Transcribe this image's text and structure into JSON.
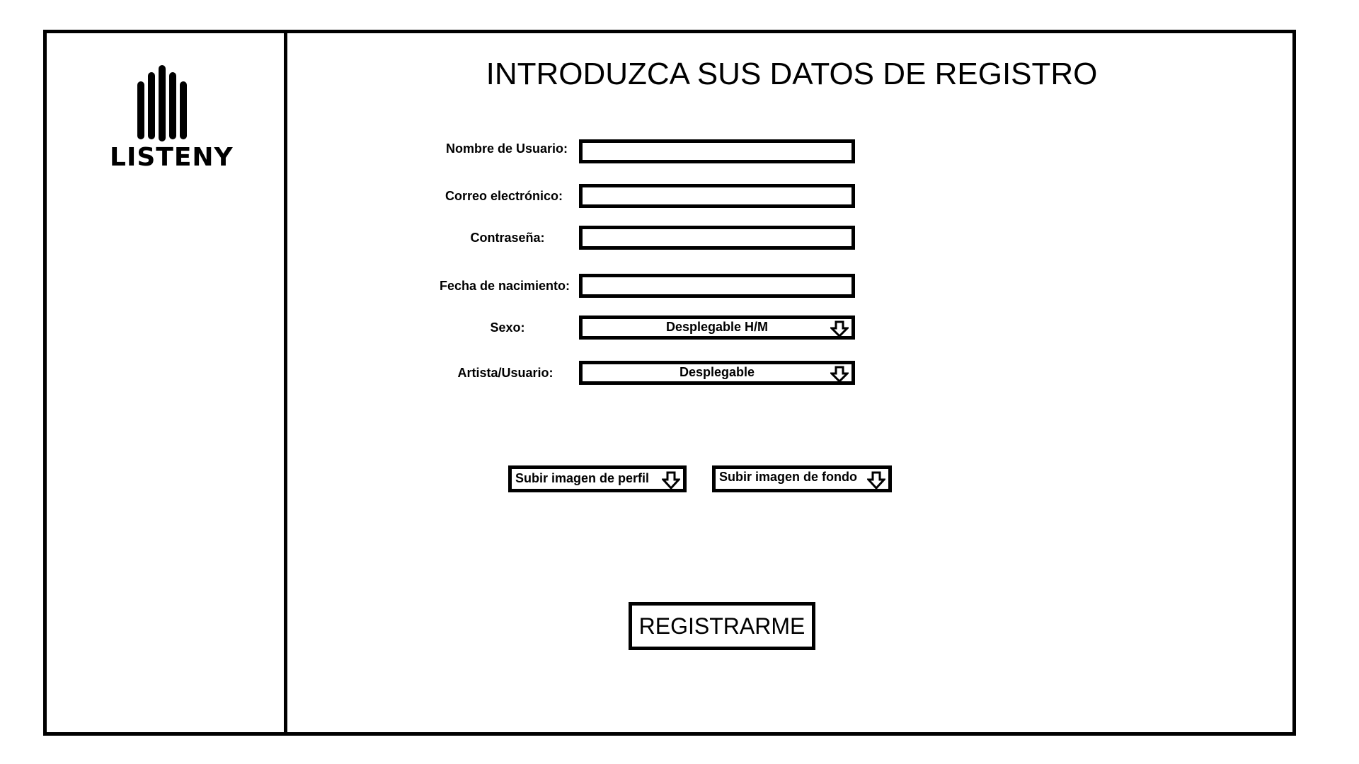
{
  "logo": {
    "text": "LISTENY",
    "icon": "sound-bars-icon"
  },
  "title": "INTRODUZCA SUS DATOS DE REGISTRO",
  "form": {
    "username_label": "Nombre de Usuario:",
    "username_value": "",
    "email_label": "Correo electrónico:",
    "email_value": "",
    "password_label": "Contraseña:",
    "password_value": "",
    "birthdate_label": "Fecha de nacimiento:",
    "birthdate_value": "",
    "sex_label": "Sexo:",
    "sex_value": "Desplegable H/M",
    "role_label": "Artista/Usuario:",
    "role_value": "Desplegable"
  },
  "uploads": {
    "profile_label": "Subir imagen de perfil",
    "background_label": "Subir imagen de fondo",
    "icon": "arrow-down-icon"
  },
  "submit_label": "REGISTRARME",
  "colors": {
    "foreground": "#000000",
    "background": "#ffffff"
  }
}
